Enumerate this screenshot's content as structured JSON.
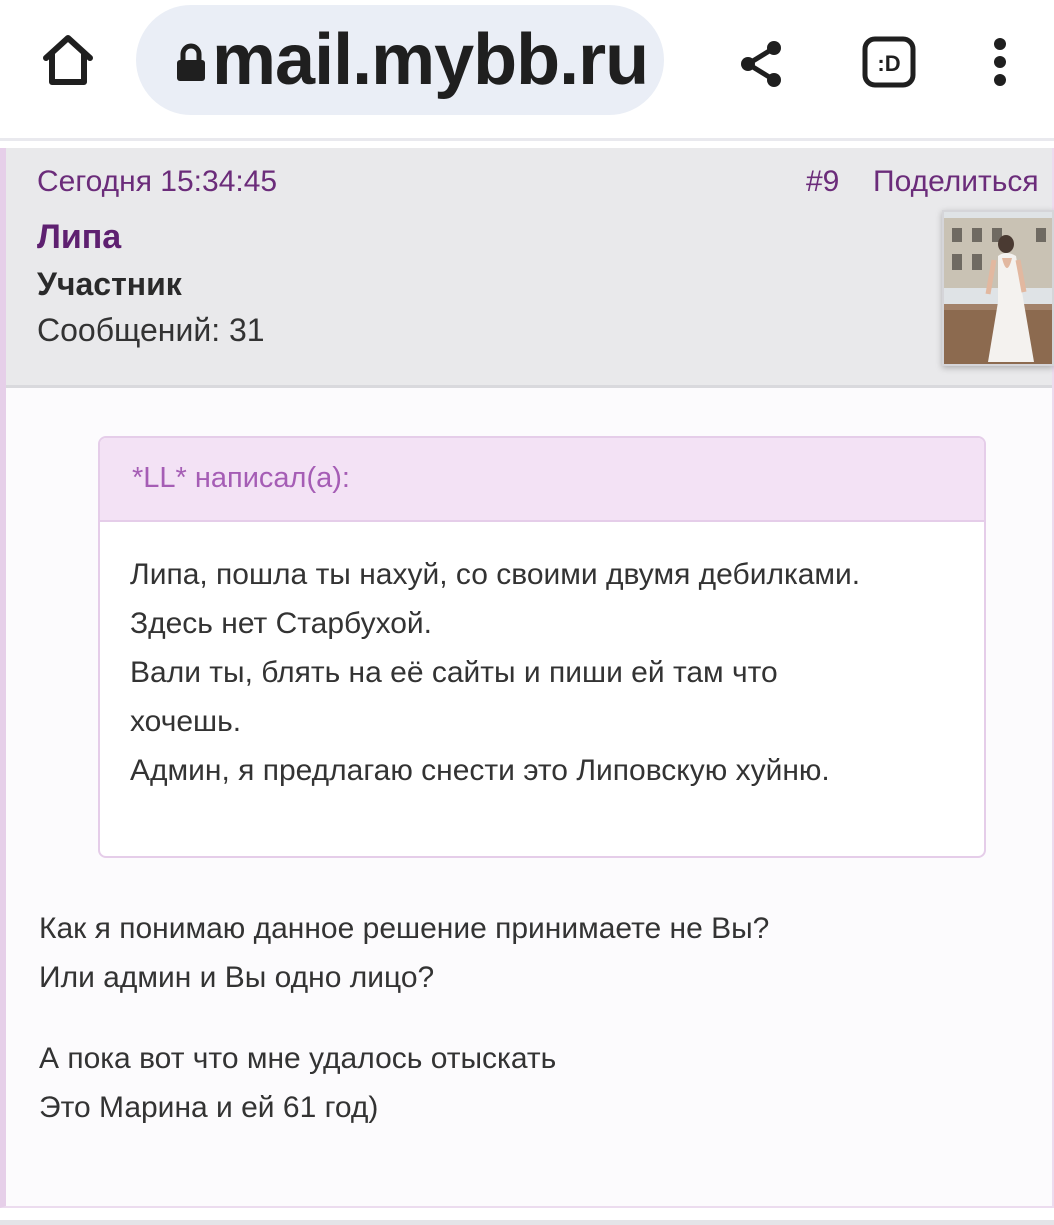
{
  "browser": {
    "url": "mail.mybb.ru",
    "home_icon": "home-icon",
    "lock_icon": "lock-icon",
    "share_icon": "share-icon",
    "extension_label": ":D",
    "menu_icon": "more-vert-icon"
  },
  "post": {
    "date": "Сегодня 15:34:45",
    "number": "#9",
    "share_label": "Поделиться",
    "author": {
      "name": "Липа",
      "role": "Участник",
      "posts": "Сообщений: 31"
    },
    "quote": {
      "header": "*LL* написал(а):",
      "lines": [
        "Липа, пошла ты нахуй, со своими двумя дебилками.",
        "Здесь нет Старбухой.",
        "Вали ты, блять на её сайты и пиши ей там что",
        "хочешь.",
        "Админ, я предлагаю снести это Липовскую хуйню."
      ]
    },
    "paragraphs": [
      [
        "Как я понимаю данное решение принимаете не Вы?",
        "Или админ и Вы одно лицо?"
      ],
      [
        "А пока вот что мне удалось отыскать",
        "Это Марина и ей 61 год)"
      ]
    ]
  },
  "colors": {
    "accent": "#6b2c7a",
    "quote_header_bg": "#f3e2f5",
    "quote_author": "#a55db5",
    "post_header_bg": "#e9e9eb"
  }
}
